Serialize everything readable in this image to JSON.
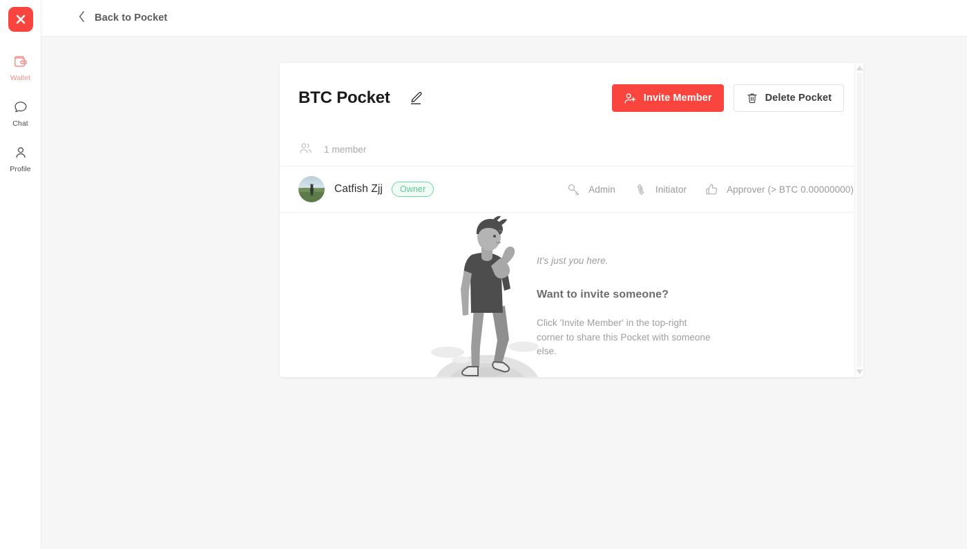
{
  "sidebar": {
    "logo_icon": "x-logo-icon",
    "items": [
      {
        "label": "Wallet",
        "icon": "wallet-icon",
        "active": true
      },
      {
        "label": "Chat",
        "icon": "chat-icon",
        "active": false
      },
      {
        "label": "Profile",
        "icon": "profile-icon",
        "active": false
      }
    ]
  },
  "topbar": {
    "back_label": "Back to Pocket",
    "back_icon": "chevron-left-icon"
  },
  "card": {
    "title": "BTC Pocket",
    "edit_icon": "pencil-edit-icon",
    "invite_button": {
      "label": "Invite Member",
      "icon": "person-plus-icon",
      "color": "#f9453e"
    },
    "delete_button": {
      "label": "Delete Pocket",
      "icon": "trash-icon"
    },
    "member_count": {
      "label": "1 member",
      "icon": "users-group-icon"
    },
    "member": {
      "name": "Catfish Zjj",
      "avatar_icon": "user-photo-avatar",
      "badge": "Owner",
      "badge_color": "#5ec994",
      "roles": [
        {
          "label": "Admin",
          "icon": "key-icon"
        },
        {
          "label": "Initiator",
          "icon": "arrows-up-down-icon"
        },
        {
          "label": "Approver (> BTC 0.00000000)",
          "icon": "thumbs-up-icon"
        }
      ]
    },
    "empty_state": {
      "illustration": "person-standing-on-hill-illustration",
      "kicker": "It's just you here.",
      "heading": "Want to invite someone?",
      "body": "Click 'Invite Member' in the top-right corner to share this Pocket with someone else."
    }
  },
  "scrollbar": {
    "up_icon": "scroll-up-arrow-icon",
    "down_icon": "scroll-down-arrow-icon"
  }
}
